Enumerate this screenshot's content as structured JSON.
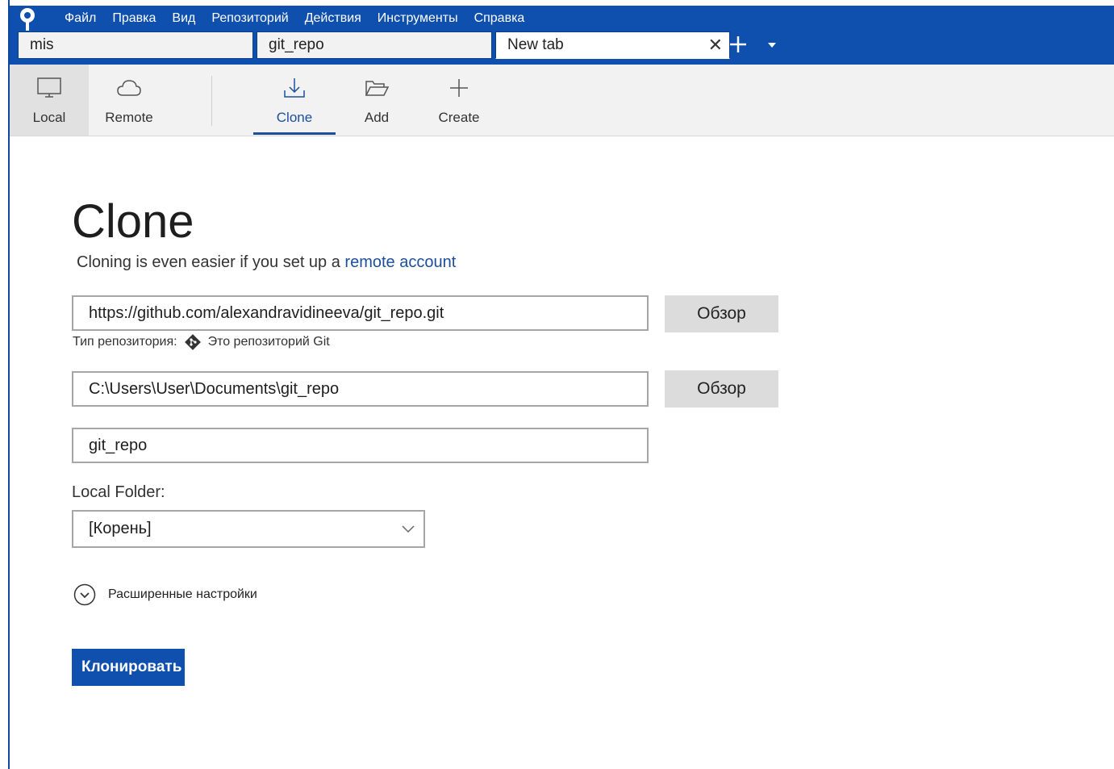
{
  "menu": [
    "Файл",
    "Правка",
    "Вид",
    "Репозиторий",
    "Действия",
    "Инструменты",
    "Справка"
  ],
  "tabs": [
    {
      "label": "mis",
      "active": false
    },
    {
      "label": "git_repo",
      "active": false
    },
    {
      "label": "New tab",
      "active": true
    }
  ],
  "toolbar": {
    "local": "Local",
    "remote": "Remote",
    "clone": "Clone",
    "add": "Add",
    "create": "Create"
  },
  "content": {
    "title": "Clone",
    "subtitle_prefix": "Cloning is even easier if you set up a ",
    "subtitle_link": "remote account",
    "source_url": "https://github.com/alexandravidineeva/git_repo.git",
    "browse_label": "Обзор",
    "repo_type_label": "Тип репозитория:",
    "repo_type_value": "Это репозиторий Git",
    "dest_path": "C:\\Users\\User\\Documents\\git_repo",
    "name": "git_repo",
    "local_folder_label": "Local Folder:",
    "local_folder_value": "[Корень]",
    "advanced_label": "Расширенные настройки",
    "clone_button": "Клонировать"
  },
  "colors": {
    "titlebar": "#0f4fae",
    "accent": "#1b4f9c"
  }
}
